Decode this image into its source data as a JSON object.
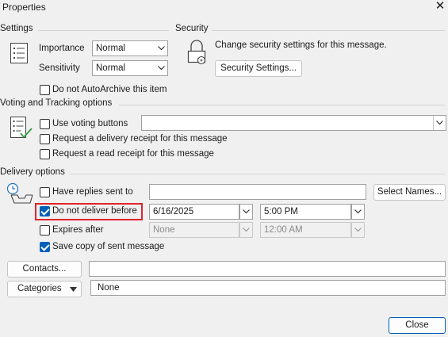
{
  "window": {
    "title": "Properties",
    "close_glyph": "✕"
  },
  "settings": {
    "section_label": "Settings",
    "importance_label": "Importance",
    "importance_value": "Normal",
    "sensitivity_label": "Sensitivity",
    "sensitivity_value": "Normal",
    "autoarchive_label": "Do not AutoArchive this item",
    "autoarchive_checked": false
  },
  "security": {
    "section_label": "Security",
    "description": "Change security settings for this message.",
    "button_label": "Security Settings..."
  },
  "voting": {
    "section_label": "Voting and Tracking options",
    "use_voting_label": "Use voting buttons",
    "use_voting_checked": false,
    "voting_value": "",
    "delivery_receipt_label": "Request a delivery receipt for this message",
    "delivery_receipt_checked": false,
    "read_receipt_label": "Request a read receipt for this message",
    "read_receipt_checked": false
  },
  "delivery": {
    "section_label": "Delivery options",
    "replies_label": "Have replies sent to",
    "replies_checked": false,
    "replies_value": "",
    "select_names_label": "Select Names...",
    "defer_label": "Do not deliver before",
    "defer_checked": true,
    "defer_date": "6/16/2025",
    "defer_time": "5:00 PM",
    "expires_label": "Expires after",
    "expires_checked": false,
    "expires_date": "None",
    "expires_time": "12:00 AM",
    "save_copy_label": "Save copy of sent message",
    "save_copy_checked": true
  },
  "contacts": {
    "button_label": "Contacts...",
    "value": ""
  },
  "categories": {
    "button_label": "Categories",
    "value": "None"
  },
  "footer": {
    "close_label": "Close"
  },
  "colors": {
    "accent": "#005fb8",
    "highlight": "#e0252b",
    "background": "#f0f0f0"
  }
}
